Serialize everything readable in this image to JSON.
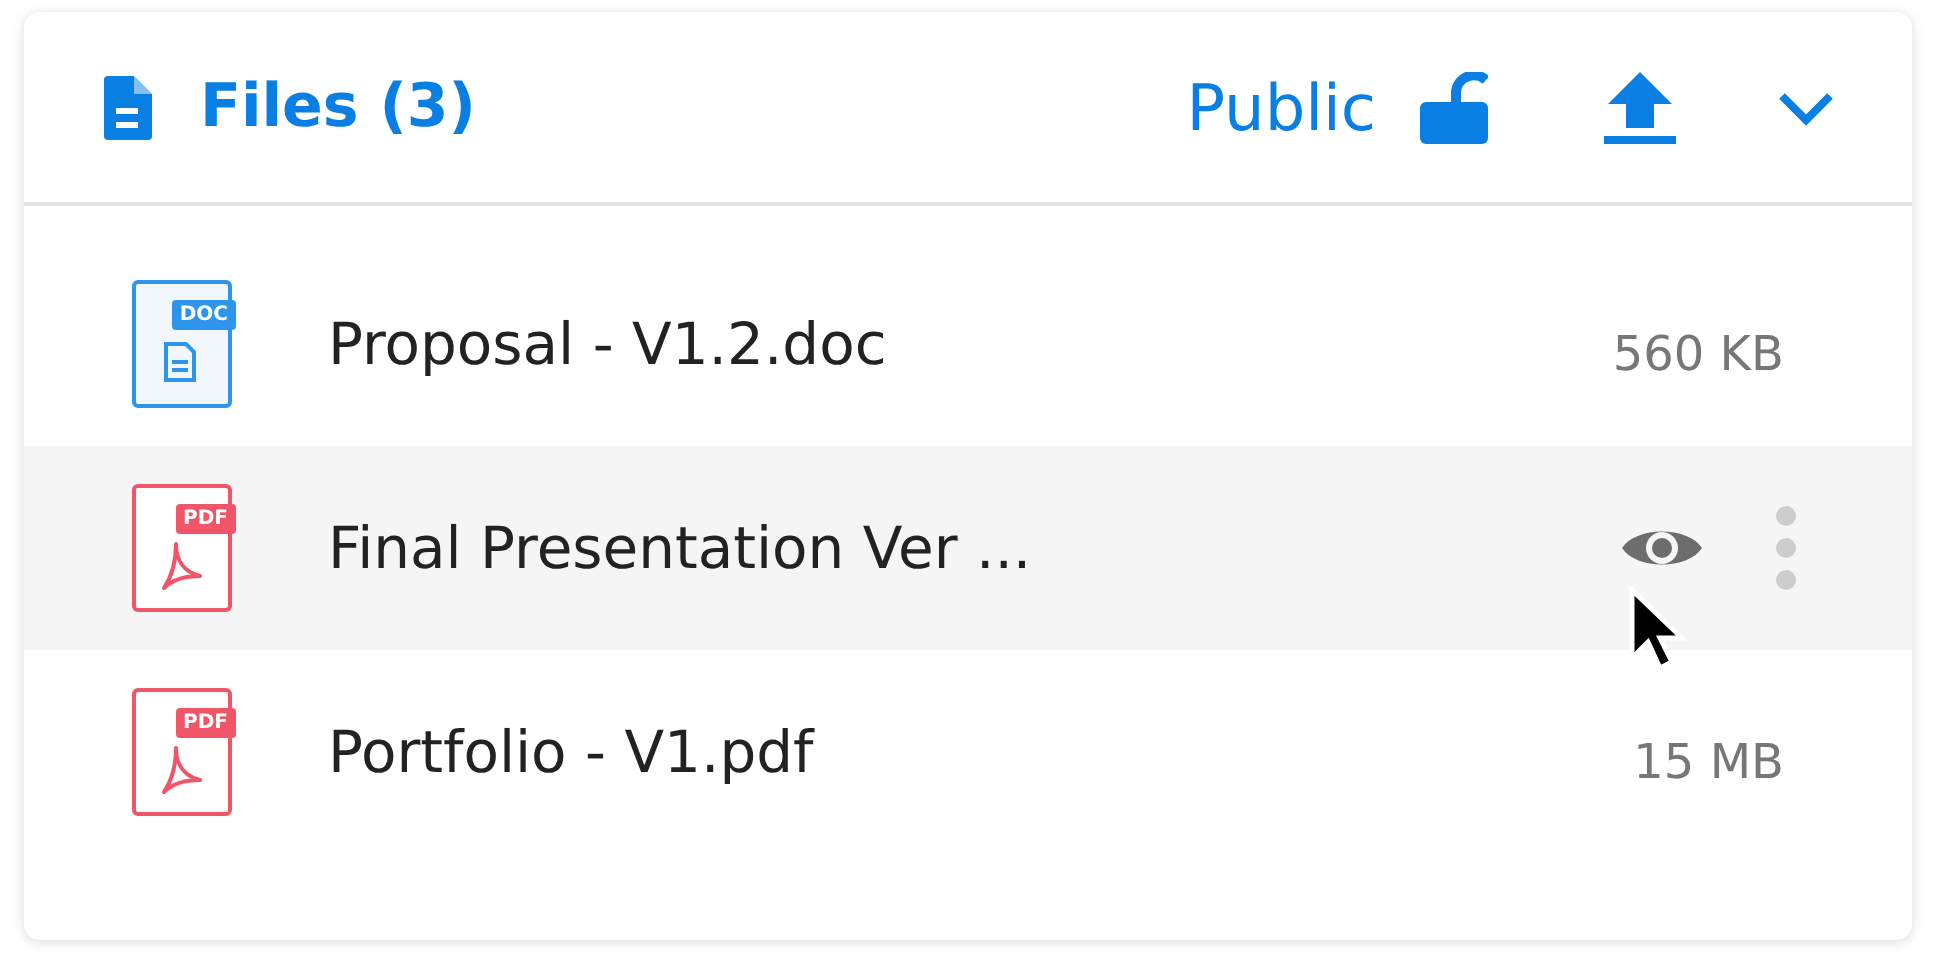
{
  "header": {
    "title": "Files (3)",
    "visibility": "Public",
    "locked": false
  },
  "files": [
    {
      "name": "Proposal - V1.2.doc",
      "kind": "doc",
      "badge": "DOC",
      "size": "560 KB",
      "hovered": false
    },
    {
      "name": "Final Presentation Ver ...",
      "kind": "pdf",
      "badge": "PDF",
      "hovered": true
    },
    {
      "name": "Portfolio - V1.pdf",
      "kind": "pdf",
      "badge": "PDF",
      "size": "15 MB",
      "hovered": false
    }
  ]
}
